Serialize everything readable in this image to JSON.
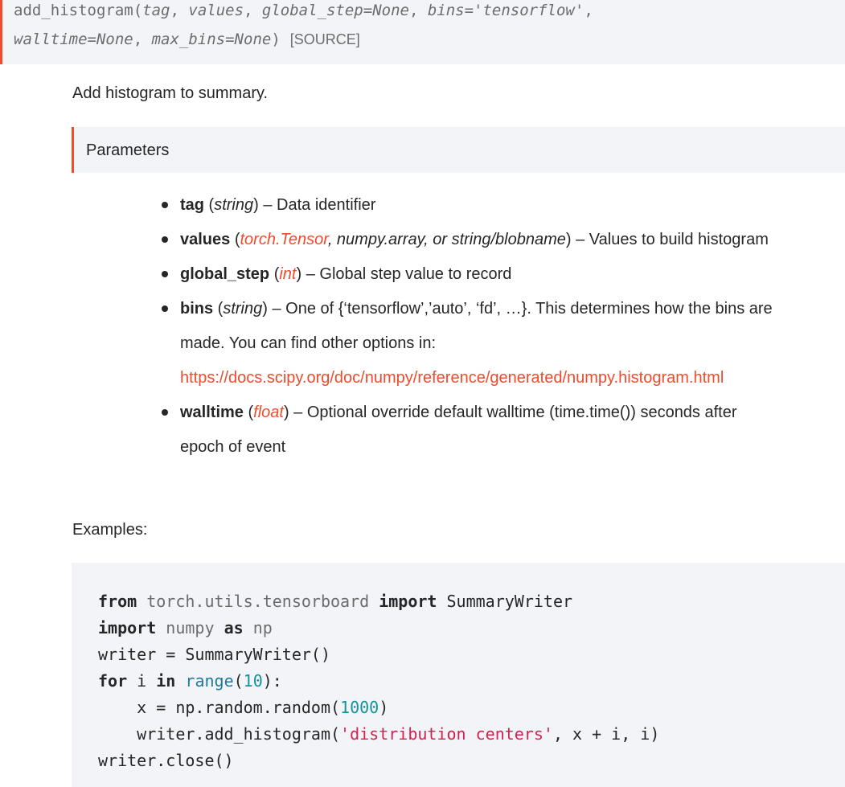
{
  "signature": {
    "name": "add_histogram",
    "open_paren": "(",
    "params_line1": [
      "tag",
      "values",
      "global_step=None",
      "bins='tensorflow'"
    ],
    "params_line2": [
      "walltime=None",
      "max_bins=None"
    ],
    "close_paren": ")",
    "source_label": "[SOURCE]"
  },
  "description": "Add histogram to summary.",
  "parameters_heading": "Parameters",
  "parameters": [
    {
      "name": "tag",
      "type_parts": [
        {
          "text": "string",
          "link": false
        }
      ],
      "description": " – Data identifier"
    },
    {
      "name": "values",
      "type_parts": [
        {
          "text": "torch.Tensor",
          "link": true
        },
        {
          "text": ", numpy.array, or string/blobname",
          "link": false
        }
      ],
      "description": " – Values to build histogram"
    },
    {
      "name": "global_step",
      "type_parts": [
        {
          "text": "int",
          "link": true
        }
      ],
      "description": " – Global step value to record"
    },
    {
      "name": "bins",
      "type_parts": [
        {
          "text": "string",
          "link": false
        }
      ],
      "description": " – One of {‘tensorflow’,’auto’, ‘fd’, …}. This determines how the bins are",
      "description_line2": "made. You can find other options in:",
      "link": "https://docs.scipy.org/doc/numpy/reference/generated/numpy.histogram.html"
    },
    {
      "name": "walltime",
      "type_parts": [
        {
          "text": "float",
          "link": true
        }
      ],
      "description": " – Optional override default walltime (time.time()) seconds after",
      "description_line2": "epoch of event"
    }
  ],
  "examples_label": "Examples:",
  "code": {
    "line1": {
      "kw_from": "from",
      "module": "torch.utils.tensorboard",
      "kw_import": "import",
      "name": "SummaryWriter"
    },
    "line2": {
      "kw_import": "import",
      "module": "numpy",
      "kw_as": "as",
      "alias": "np"
    },
    "line3": "writer = SummaryWriter()",
    "line4": {
      "kw_for": "for",
      "var": "i",
      "kw_in": "in",
      "builtin": "range",
      "open": "(",
      "num": "10",
      "close": "):"
    },
    "line5": {
      "pre": "    x = np.random.random(",
      "num": "1000",
      "post": ")"
    },
    "line6": {
      "pre": "    writer.add_histogram(",
      "str": "'distribution centers'",
      "post": ", x + i, i)"
    },
    "line7": "writer.close()"
  },
  "colors": {
    "accent": "#ee4c2c",
    "panel_background": "#f3f4f7",
    "code_string": "#d6204e",
    "code_number": "#14939c",
    "code_builtin": "#1f7a9a"
  }
}
